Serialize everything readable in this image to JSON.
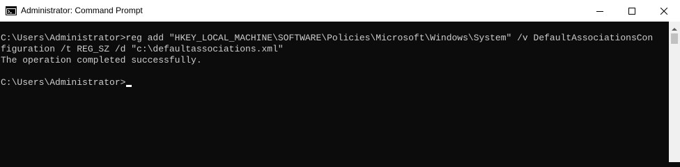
{
  "window": {
    "title": "Administrator: Command Prompt",
    "icon": "cmd-icon",
    "controls": {
      "minimize_icon": "minimize-icon",
      "maximize_icon": "maximize-icon",
      "close_icon": "close-icon"
    }
  },
  "console": {
    "lines": [
      "C:\\Users\\Administrator>reg add \"HKEY_LOCAL_MACHINE\\SOFTWARE\\Policies\\Microsoft\\Windows\\System\" /v DefaultAssociationsCon",
      "figuration /t REG_SZ /d \"c:\\defaultassociations.xml\"",
      "The operation completed successfully.",
      "C:\\Users\\Administrator>"
    ],
    "colors": {
      "background": "#0c0c0c",
      "text": "#cccccc"
    }
  },
  "scrollbar": {
    "up_icon": "scroll-up-arrow-icon"
  }
}
